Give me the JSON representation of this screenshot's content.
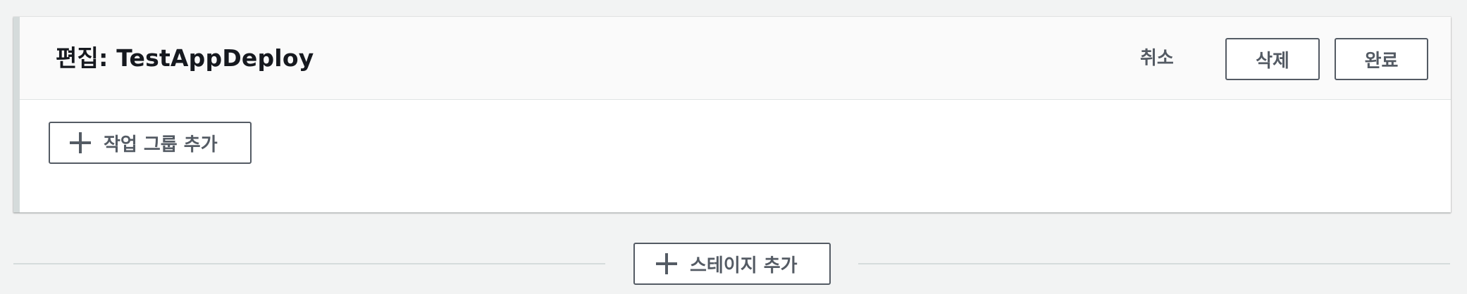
{
  "stage": {
    "title": "편집: TestAppDeploy",
    "cancel_label": "취소",
    "delete_label": "삭제",
    "done_label": "완료",
    "add_action_group_label": "작업 그룹 추가"
  },
  "pipeline": {
    "add_stage_label": "스테이지 추가"
  },
  "icons": {
    "plus": "plus-icon"
  },
  "colors": {
    "background": "#f2f3f3",
    "panel": "#ffffff",
    "header": "#fafafa",
    "accent_bar": "#d5dbdb",
    "button_text": "#545b64",
    "title_text": "#16191f"
  }
}
